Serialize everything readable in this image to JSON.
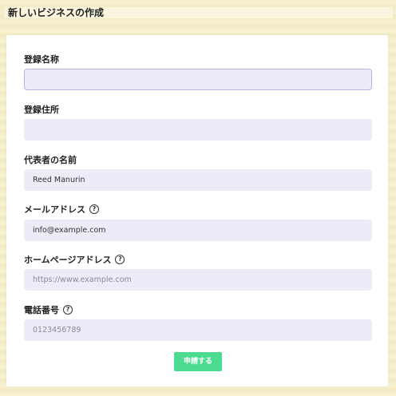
{
  "title": "新しいビジネスの作成",
  "form": {
    "reg_name": {
      "label": "登録名称",
      "value": ""
    },
    "reg_address": {
      "label": "登録住所",
      "value": ""
    },
    "rep_name": {
      "label": "代表者の名前",
      "value": "Reed Manurin"
    },
    "email": {
      "label": "メールアドレス",
      "value": "info@example.com",
      "help_icon": "question-circle"
    },
    "homepage": {
      "label": "ホームページアドレス",
      "placeholder": "https://www.example.com",
      "help_icon": "question-circle"
    },
    "phone": {
      "label": "電話番号",
      "placeholder": "0123456789",
      "help_icon": "question-circle"
    },
    "submit_label": "申請する"
  },
  "colors": {
    "accent": "#4cdc8f",
    "input_bg": "#ecebf7"
  }
}
